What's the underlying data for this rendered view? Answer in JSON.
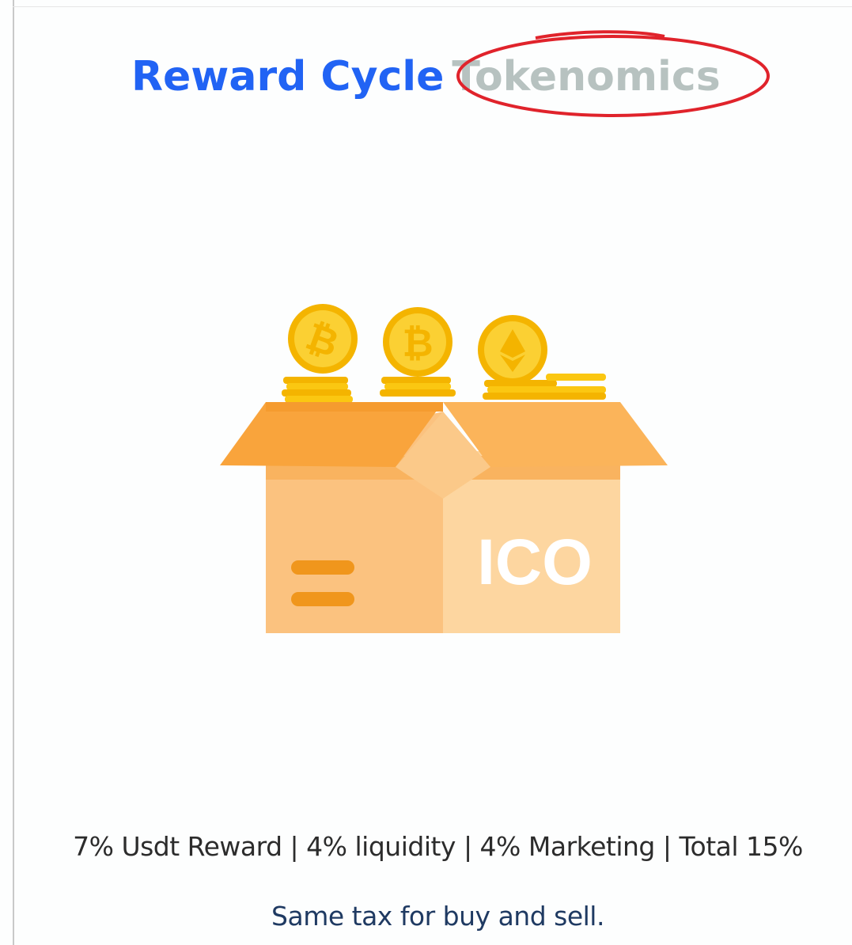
{
  "header": {
    "title_primary": "Reward Cycle",
    "title_secondary": "Tokenomics"
  },
  "illustration": {
    "box_label": "ICO",
    "coins": [
      "bitcoin-coin",
      "bitcoin-coin",
      "ethereum-coin"
    ]
  },
  "tax": {
    "breakdown": "7% Usdt Reward |  4% liquidity | 4% Marketing | Total 15%",
    "note": "Same tax for buy and sell."
  },
  "colors": {
    "title_primary": "#2163f4",
    "title_secondary": "#b7c2c0",
    "annotation": "#e0232b",
    "box_front": "#fbc27f",
    "box_side": "#fdd6a0",
    "box_flap": "#f9a43c",
    "coin": "#fbc711",
    "note_text": "#1f3a62"
  }
}
